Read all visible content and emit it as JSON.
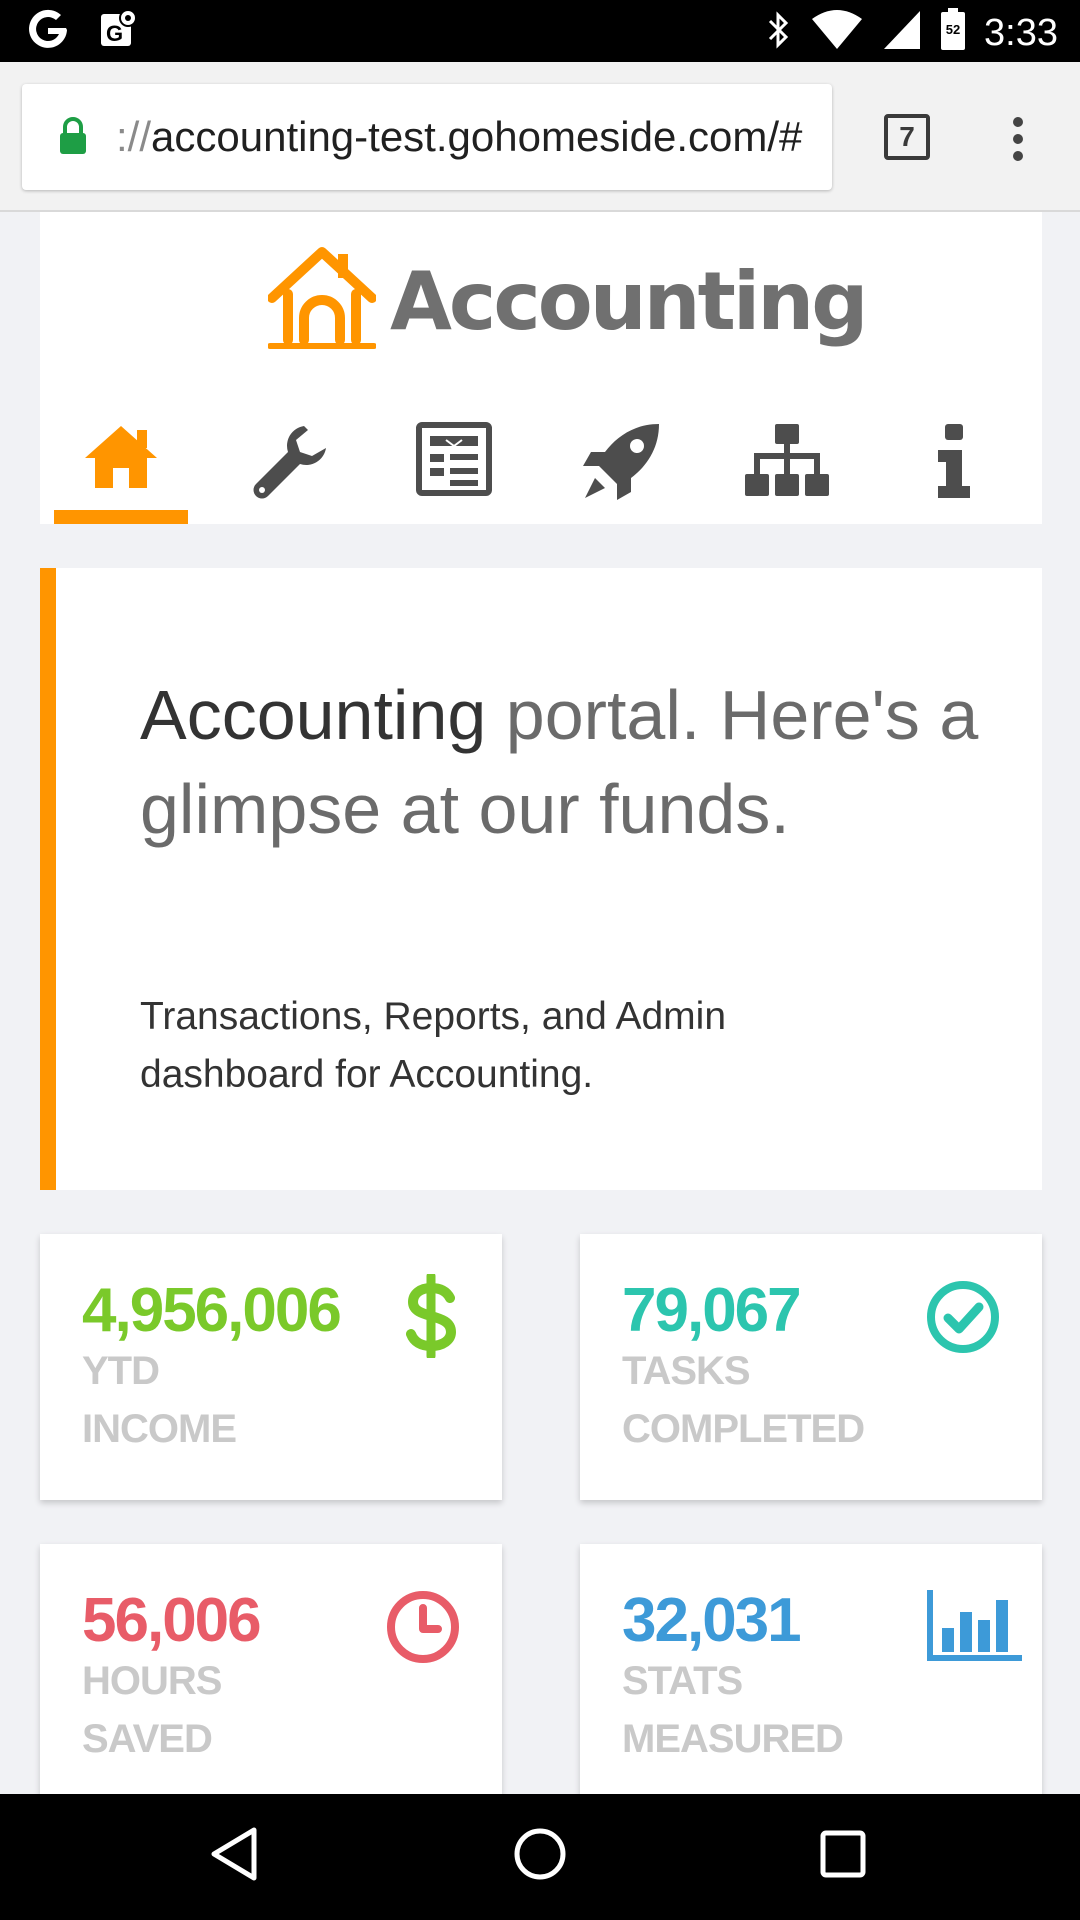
{
  "status_bar": {
    "time": "3:33",
    "battery_level": "52",
    "icons": [
      "google-icon",
      "maps-icon",
      "bluetooth-icon",
      "wifi-icon",
      "signal-icon",
      "battery-icon"
    ]
  },
  "browser": {
    "url_scheme": "://",
    "url_host": "accounting-test.gohomeside.com/#",
    "tab_count": "7",
    "lock_color": "#1e9e45"
  },
  "header": {
    "logo_text": "Accounting",
    "accent_color": "#ff9500",
    "nav": [
      {
        "icon": "home-icon",
        "active": true
      },
      {
        "icon": "wrench-icon",
        "active": false
      },
      {
        "icon": "newspaper-icon",
        "active": false
      },
      {
        "icon": "rocket-icon",
        "active": false
      },
      {
        "icon": "sitemap-icon",
        "active": false
      },
      {
        "icon": "info-icon",
        "active": false
      }
    ]
  },
  "hero": {
    "title_strong": "Accounting",
    "title_rest": " portal. Here's a glimpse at our funds.",
    "subtitle": "Transactions, Reports, and Admin dashboard for Accounting."
  },
  "stats": [
    {
      "value": "4,956,006",
      "label_line1": "YTD",
      "label_line2": "INCOME",
      "color": "#7ac92a",
      "icon": "dollar-icon"
    },
    {
      "value": "79,067",
      "label_line1": "TASKS",
      "label_line2": "COMPLETED",
      "color": "#2cc5ae",
      "icon": "check-circle-icon"
    },
    {
      "value": "56,006",
      "label_line1": "HOURS",
      "label_line2": "SAVED",
      "color": "#e85c68",
      "icon": "clock-icon"
    },
    {
      "value": "32,031",
      "label_line1": "STATS",
      "label_line2": "MEASURED",
      "color": "#3d9ad8",
      "icon": "bar-chart-icon"
    }
  ]
}
